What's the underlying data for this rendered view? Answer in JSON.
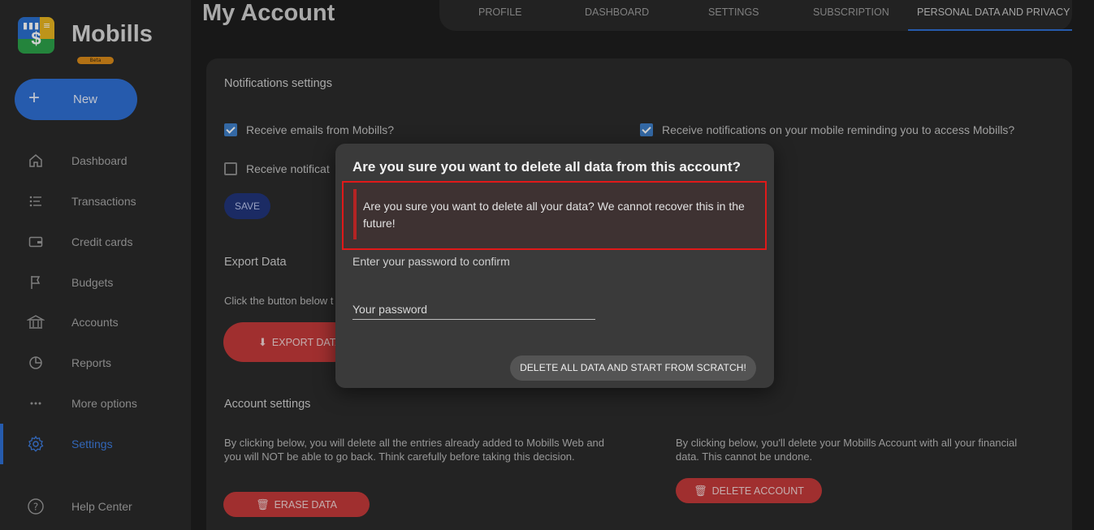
{
  "app": {
    "brand": "Mobills",
    "beta_label": "Beta",
    "new_label": "New",
    "accent_color": "#2f6fd4"
  },
  "sidebar": {
    "items": [
      {
        "label": "Dashboard",
        "icon": "home-icon"
      },
      {
        "label": "Transactions",
        "icon": "list-icon"
      },
      {
        "label": "Credit cards",
        "icon": "credit-card-icon"
      },
      {
        "label": "Budgets",
        "icon": "flag-icon"
      },
      {
        "label": "Accounts",
        "icon": "bank-icon"
      },
      {
        "label": "Reports",
        "icon": "pie-chart-icon"
      },
      {
        "label": "More options",
        "icon": "more-dots-icon"
      },
      {
        "label": "Settings",
        "icon": "gear-icon",
        "active": true
      },
      {
        "label": "Help Center",
        "icon": "help-icon"
      }
    ]
  },
  "header": {
    "title": "My Account",
    "tabs": [
      {
        "label": "PROFILE"
      },
      {
        "label": "DASHBOARD"
      },
      {
        "label": "SETTINGS"
      },
      {
        "label": "SUBSCRIPTION"
      },
      {
        "label": "PERSONAL DATA AND PRIVACY",
        "active": true
      }
    ]
  },
  "notifications": {
    "title": "Notifications settings",
    "options": [
      {
        "label": "Receive emails from Mobills?",
        "checked": true
      },
      {
        "label": "Receive notifications on your mobile reminding you to access Mobills?",
        "checked": true
      },
      {
        "label": "Receive notificat",
        "checked": false
      }
    ],
    "save_label": "SAVE"
  },
  "export": {
    "title": "Export Data",
    "description": "Click the button below t",
    "button_label": "EXPORT DATA"
  },
  "account_settings": {
    "title": "Account settings",
    "erase_description": "By clicking below, you will delete all the entries already added to Mobills Web and you will NOT be able to go back. Think carefully before taking this decision.",
    "erase_label": "ERASE DATA",
    "delete_description": "By clicking below, you'll delete your Mobills Account with all your financial data. This cannot be undone.",
    "delete_label": "DELETE ACCOUNT"
  },
  "modal": {
    "title": "Are you sure you want to delete all data from this account?",
    "warning": "Are you sure you want to delete all your data? We cannot recover this in the future!",
    "confirm_label": "Enter your password to confirm",
    "password_placeholder": "Your password",
    "password_value": "",
    "confirm_button": "DELETE ALL DATA AND START FROM SCRATCH!"
  }
}
